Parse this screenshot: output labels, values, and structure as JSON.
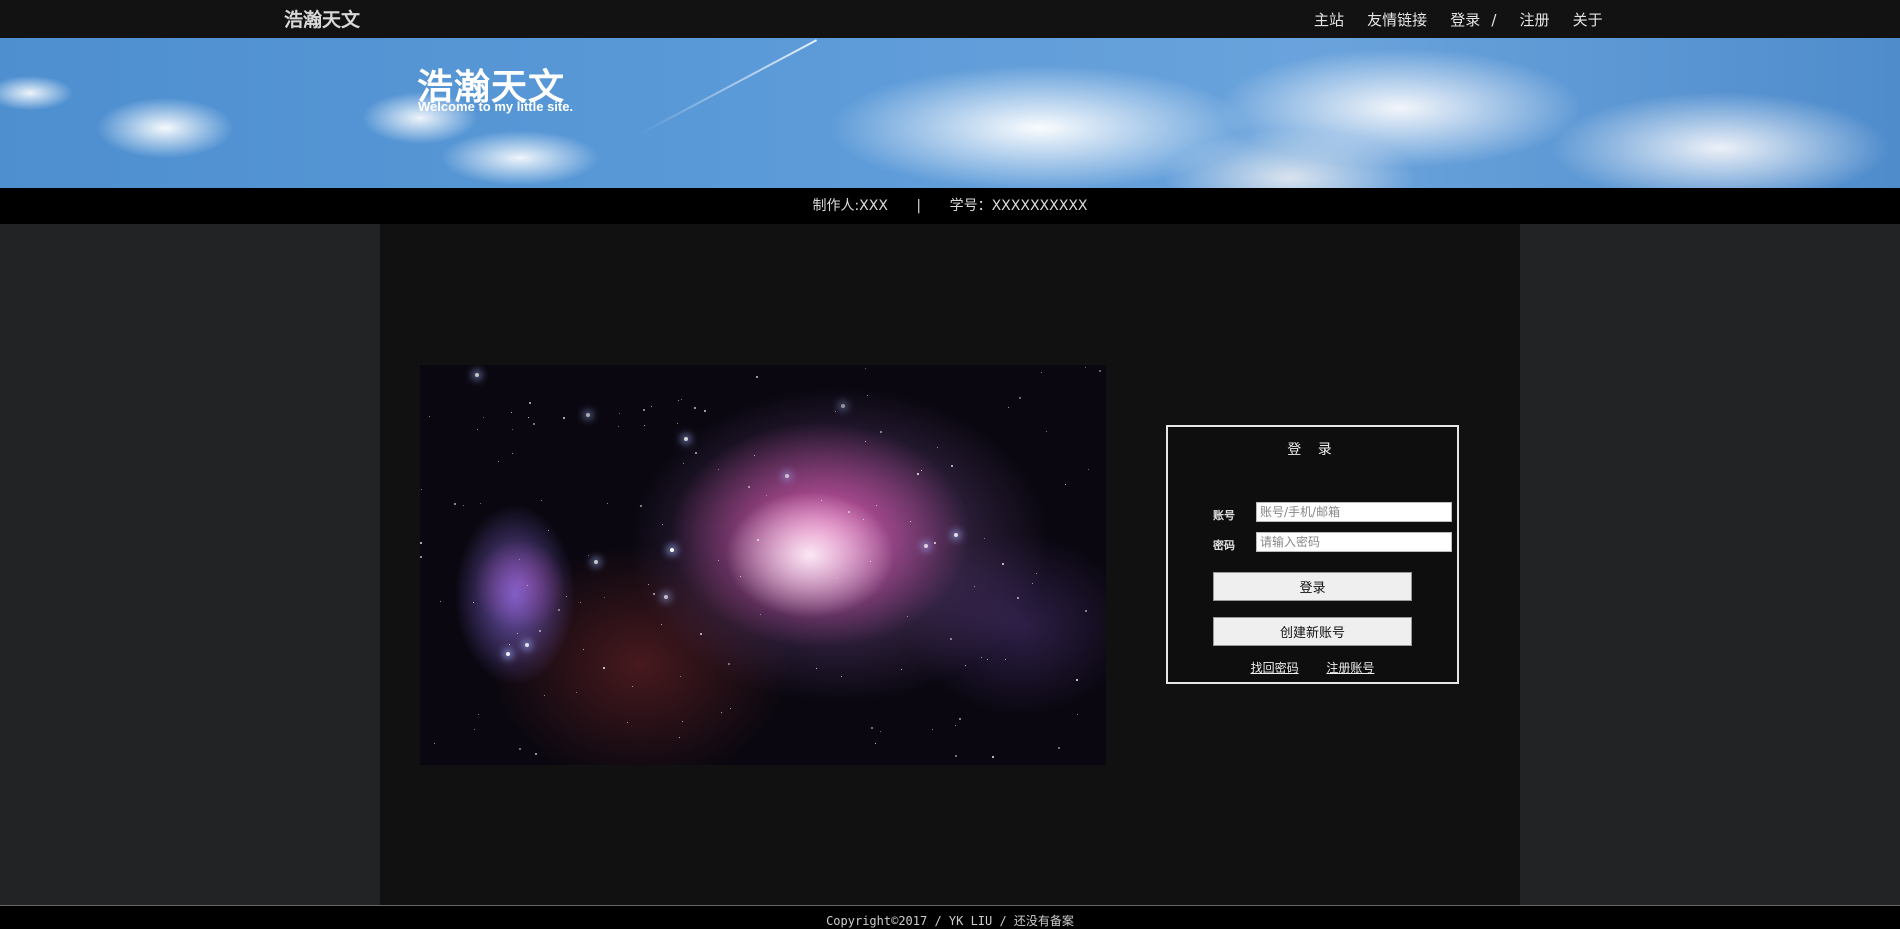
{
  "topnav": {
    "brand": "浩瀚天文",
    "links": [
      "主站",
      "友情链接",
      "登录",
      "注册",
      "关于"
    ],
    "login_separator": "/"
  },
  "banner": {
    "title": "浩瀚天文",
    "subtitle": "Welcome to my little site."
  },
  "credits": {
    "author": "制作人:XXX",
    "divider": "|",
    "student_id": "学号：XXXXXXXXXX"
  },
  "login": {
    "title": "登 录",
    "account_label": "账号",
    "account_placeholder": "账号/手机/邮箱",
    "password_label": "密码",
    "password_placeholder": "请输入密码",
    "login_button": "登录",
    "create_button": "创建新账号",
    "forgot_link": "找回密码",
    "register_link": "注册账号"
  },
  "footer": {
    "text": "Copyright©2017 / YK LIU / 还没有备案"
  },
  "colors": {
    "page_bg": "#222324",
    "panel_bg": "#111111",
    "bar_bg": "#000000",
    "nav_bg": "#121212"
  },
  "icons": {
    "nebula": "orion-nebula-image"
  }
}
